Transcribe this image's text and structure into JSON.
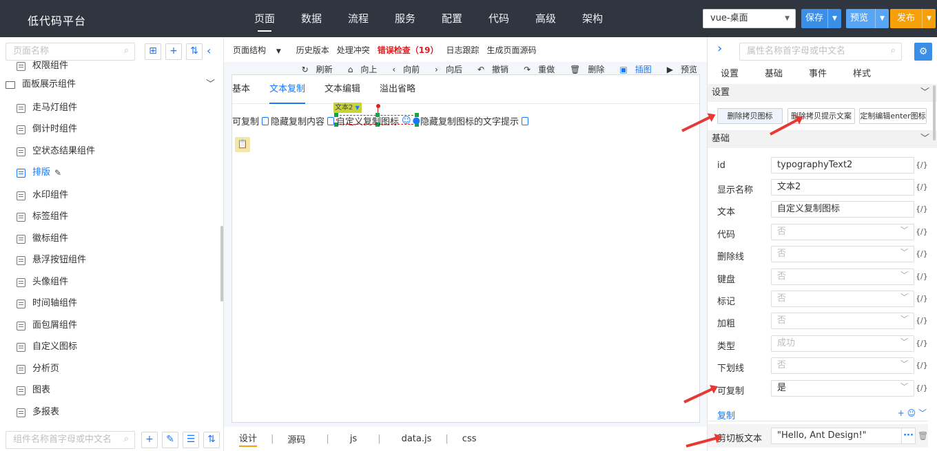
{
  "app": {
    "title": "低代码平台"
  },
  "nav": {
    "items": [
      "页面",
      "数据",
      "流程",
      "服务",
      "配置",
      "代码",
      "高级",
      "架构"
    ],
    "active": "页面"
  },
  "header": {
    "env_value": "vue-桌面",
    "save_label": "保存",
    "preview_label": "预览",
    "publish_label": "发布"
  },
  "colors": {
    "topbar": "#2f3640",
    "accent": "#1677ff",
    "save": "#3a8ee6",
    "preview": "#59a5f5",
    "publish": "#f5a00b",
    "error": "#e02020"
  },
  "left": {
    "search_placeholder": "页面名称",
    "group_label": "面板展示组件",
    "partial_item": "权限组件",
    "items": [
      "走马灯组件",
      "倒计时组件",
      "空状态结果组件",
      "排版",
      "水印组件",
      "标签组件",
      "徽标组件",
      "悬浮按钮组件",
      "头像组件",
      "时间轴组件",
      "面包屑组件",
      "自定义图标",
      "分析页",
      "图表",
      "多报表"
    ],
    "active_item": "排版",
    "bottom_search_placeholder": "组件名称首字母或中文名"
  },
  "center": {
    "toolbar1": [
      "页面结构",
      "历史版本",
      "处理冲突",
      "错误检查（19）",
      "日志跟踪",
      "生成页面源码"
    ],
    "toolbar2": [
      "刷新",
      "向上",
      "向前",
      "向后",
      "撤销",
      "重做",
      "删除",
      "插图",
      "预览"
    ],
    "canvas_tabs": [
      "基本",
      "文本复制",
      "文本编辑",
      "溢出省略"
    ],
    "active_tab": "文本复制",
    "selection_tag": "文本2",
    "copy_texts": [
      "可复制",
      "隐藏复制内容",
      "自定义复制图标",
      "隐藏复制图标的文字提示"
    ],
    "bottom_tabs": [
      "设计",
      "源码",
      "js",
      "data.js",
      "css"
    ]
  },
  "right": {
    "search_placeholder": "属性名称首字母或中文名",
    "tabs": [
      "设置",
      "基础",
      "事件",
      "样式"
    ],
    "section_settings": "设置",
    "buttons": [
      "删除拷贝图标",
      "删除拷贝提示文案",
      "定制编辑enter图标"
    ],
    "section_basic": "基础",
    "props": [
      {
        "label": "id",
        "value": "typographyText2",
        "type": "text"
      },
      {
        "label": "显示名称",
        "value": "文本2",
        "type": "text"
      },
      {
        "label": "文本",
        "value": "自定义复制图标",
        "type": "text"
      },
      {
        "label": "代码",
        "value": "否",
        "type": "select-disabled"
      },
      {
        "label": "删除线",
        "value": "否",
        "type": "select-disabled"
      },
      {
        "label": "键盘",
        "value": "否",
        "type": "select-disabled"
      },
      {
        "label": "标记",
        "value": "否",
        "type": "select-disabled"
      },
      {
        "label": "加粗",
        "value": "否",
        "type": "select-disabled"
      },
      {
        "label": "类型",
        "value": "成功",
        "type": "select-disabled"
      },
      {
        "label": "下划线",
        "value": "否",
        "type": "select-disabled"
      },
      {
        "label": "可复制",
        "value": "是",
        "type": "select"
      }
    ],
    "fx_label": "{/}",
    "section_copy": "复制",
    "clipboard_label": "剪切板文本",
    "clipboard_value": "\"Hello, Ant Design!\""
  }
}
